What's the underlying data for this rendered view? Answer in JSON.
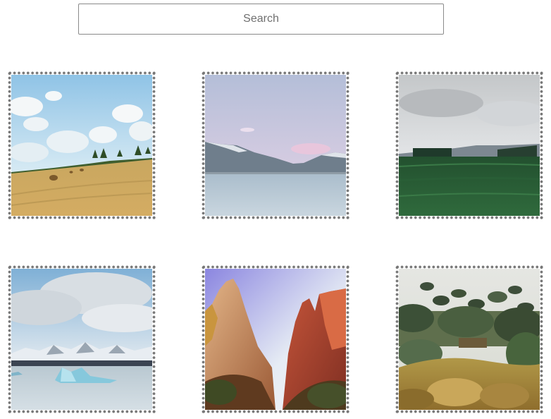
{
  "search": {
    "placeholder": "Search",
    "value": ""
  },
  "gallery": {
    "photos": [
      {
        "id": "hayfield",
        "subject": "hay-field-landscape"
      },
      {
        "id": "lake",
        "subject": "mountain-lake-landscape"
      },
      {
        "id": "meadow",
        "subject": "green-meadow-landscape"
      },
      {
        "id": "glacier",
        "subject": "glacier-lagoon-landscape"
      },
      {
        "id": "canyon",
        "subject": "red-rock-canyon-landscape"
      },
      {
        "id": "garden",
        "subject": "wild-garden-landscape"
      }
    ]
  },
  "colors": {
    "tile_border_dots": "#777777",
    "search_border": "#8a8a8a"
  }
}
